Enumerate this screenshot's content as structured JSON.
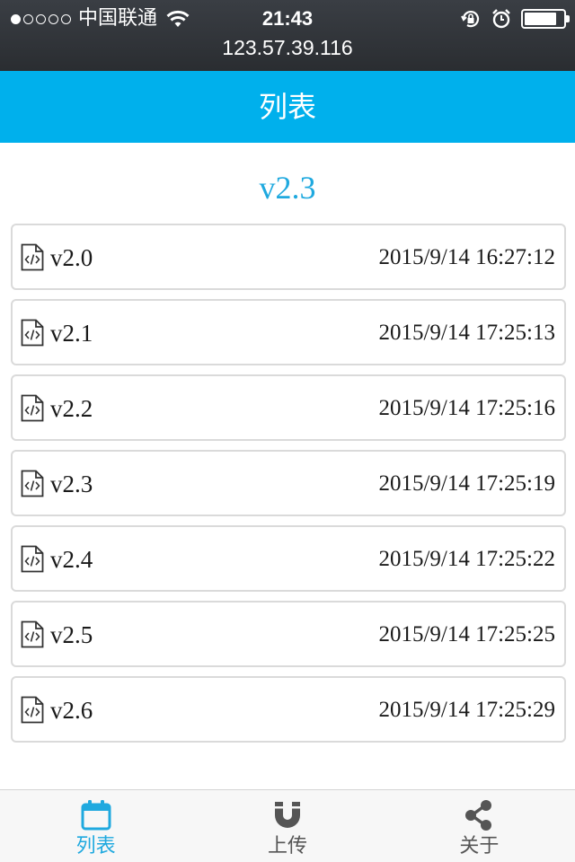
{
  "status_bar": {
    "carrier": "中国联通",
    "time": "21:43",
    "url": "123.57.39.116",
    "signal_strength": 1,
    "signal_max": 5,
    "battery_level": 0.8,
    "icons": [
      "wifi-icon",
      "rotation-lock-icon",
      "alarm-icon",
      "battery-icon"
    ]
  },
  "header": {
    "title": "列表"
  },
  "current_version": "v2.3",
  "files": [
    {
      "name": "v2.0",
      "date": "2015/9/14 16:27:12",
      "icon": "code-file-icon"
    },
    {
      "name": "v2.1",
      "date": "2015/9/14 17:25:13",
      "icon": "code-file-icon"
    },
    {
      "name": "v2.2",
      "date": "2015/9/14 17:25:16",
      "icon": "code-file-icon"
    },
    {
      "name": "v2.3",
      "date": "2015/9/14 17:25:19",
      "icon": "code-file-icon"
    },
    {
      "name": "v2.4",
      "date": "2015/9/14 17:25:22",
      "icon": "code-file-icon"
    },
    {
      "name": "v2.5",
      "date": "2015/9/14 17:25:25",
      "icon": "code-file-icon"
    },
    {
      "name": "v2.6",
      "date": "2015/9/14 17:25:29",
      "icon": "code-file-icon"
    }
  ],
  "tabs": [
    {
      "label": "列表",
      "icon": "calendar-icon",
      "active": true
    },
    {
      "label": "上传",
      "icon": "magnet-icon",
      "active": false
    },
    {
      "label": "关于",
      "icon": "share-icon",
      "active": false
    }
  ],
  "colors": {
    "accent": "#00b0ec",
    "accent_text": "#1fa9df",
    "inactive_tab": "#555555"
  }
}
